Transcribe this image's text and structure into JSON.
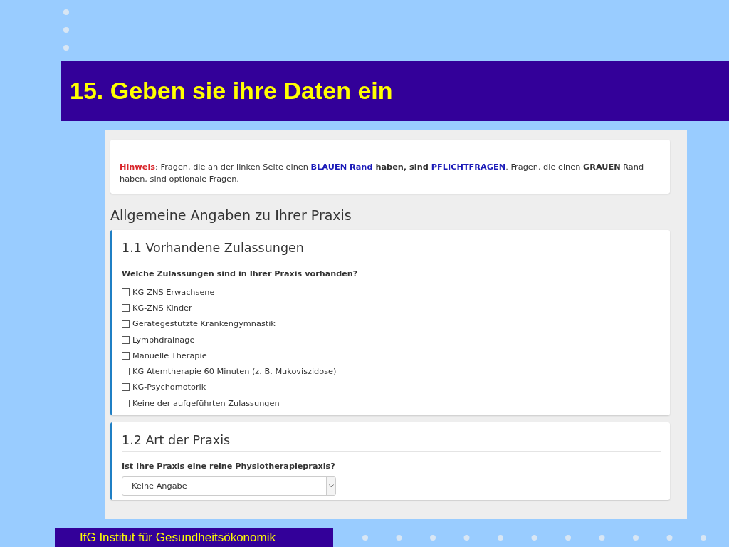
{
  "slide_title": "15. Geben sie ihre Daten ein",
  "notice": [
    {
      "kind": "alert",
      "text": "Hinweis"
    },
    {
      "kind": "plain",
      "text": ": Fragen, die an der linken Seite einen "
    },
    {
      "kind": "required",
      "text": "BLAUEN Rand"
    },
    {
      "kind": "bold",
      "text": " haben, sind "
    },
    {
      "kind": "required",
      "text": "PFLICHTFRAGEN"
    },
    {
      "kind": "plain",
      "text": ". Fragen, die einen "
    },
    {
      "kind": "bold",
      "text": "GRAUEN"
    },
    {
      "kind": "plain",
      "text": " Rand haben, sind optionale Fragen."
    }
  ],
  "section_title": "Allgemeine Angaben zu Ihrer Praxis",
  "questions": [
    {
      "kind": "checkboxes",
      "title": "1.1 Vorhandene Zulassungen",
      "question": "Welche Zulassungen sind in Ihrer Praxis vorhanden?",
      "options": [
        {
          "label": "KG-ZNS Erwachsene",
          "checked": false
        },
        {
          "label": "KG-ZNS Kinder",
          "checked": false
        },
        {
          "label": "Gerätegestützte Krankengymnastik",
          "checked": false
        },
        {
          "label": "Lymphdrainage",
          "checked": false
        },
        {
          "label": "Manuelle Therapie",
          "checked": false
        },
        {
          "label": "KG Atemtherapie 60 Minuten (z. B. Mukoviszidose)",
          "checked": false
        },
        {
          "label": "KG-Psychomotorik",
          "checked": false
        },
        {
          "label": "Keine der aufgeführten Zulassungen",
          "checked": false
        }
      ]
    },
    {
      "kind": "select",
      "title": "1.2 Art der Praxis",
      "question": "Ist Ihre Praxis eine reine Physiotherapiepraxis?",
      "value": "Keine Angabe"
    }
  ],
  "footer": "IfG Institut für Gesundheitsökonomik"
}
